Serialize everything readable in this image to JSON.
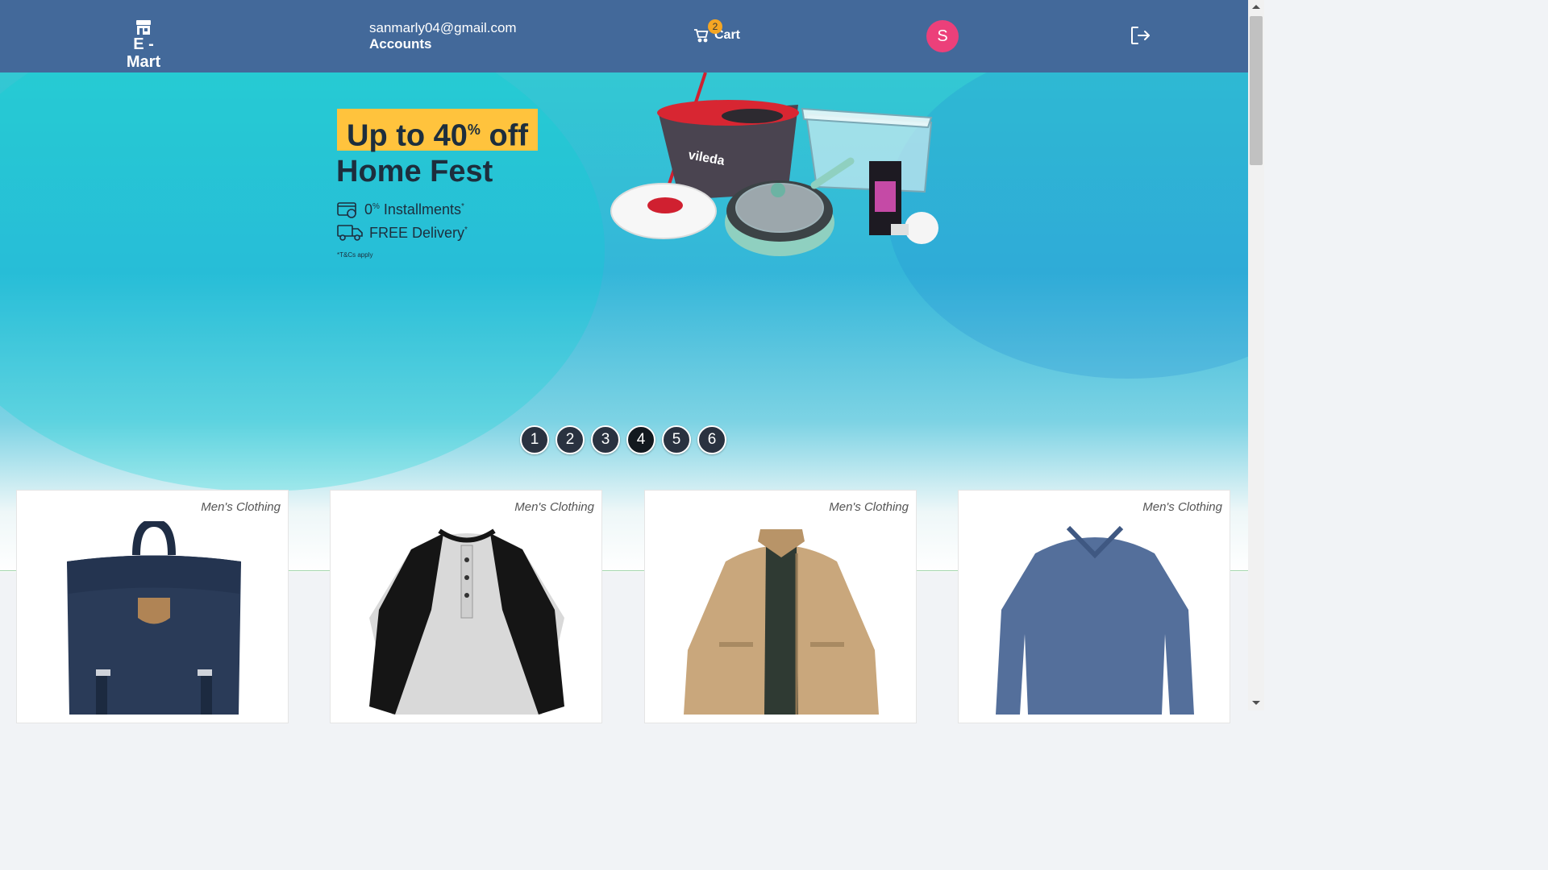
{
  "header": {
    "brand": "E - Mart",
    "email": "sanmarly04@gmail.com",
    "accounts_label": "Accounts",
    "cart_label": "Cart",
    "cart_count": "2",
    "avatar_initial": "S"
  },
  "hero": {
    "promo_prefix": "Up to 40",
    "promo_percent": "%",
    "promo_suffix": " off",
    "title": "Home Fest",
    "installments_prefix": "0",
    "installments_percent": "%",
    "installments_text": " Installments",
    "installments_star": "*",
    "delivery_text": "FREE Delivery",
    "delivery_star": "*",
    "tc": "*T&Cs apply",
    "brand_on_bucket": "vileda"
  },
  "carousel": {
    "pages": [
      "1",
      "2",
      "3",
      "4",
      "5",
      "6"
    ],
    "active_index": 3
  },
  "products": [
    {
      "category": "Men's Clothing",
      "icon": "backpack-image"
    },
    {
      "category": "Men's Clothing",
      "icon": "raglan-shirt-image"
    },
    {
      "category": "Men's Clothing",
      "icon": "jacket-image"
    },
    {
      "category": "Men's Clothing",
      "icon": "tshirt-image"
    }
  ],
  "colors": {
    "header": "#43699a",
    "accent_avatar": "#ec407a",
    "badge": "#f5a623",
    "promo_yellow": "#ffc33d"
  }
}
